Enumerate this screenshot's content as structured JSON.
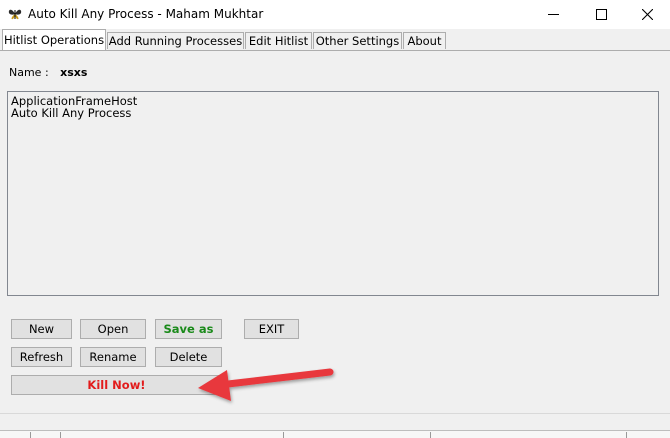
{
  "window": {
    "title": "Auto Kill Any Process - Maham Mukhtar"
  },
  "tabs": [
    {
      "label": "Hitlist Operations",
      "active": true
    },
    {
      "label": "Add Running Processes",
      "active": false
    },
    {
      "label": "Edit Hitlist",
      "active": false
    },
    {
      "label": "Other Settings",
      "active": false
    },
    {
      "label": "About",
      "active": false
    }
  ],
  "hitlist": {
    "name_label": "Name :",
    "name_value": "xsxs",
    "items": [
      "ApplicationFrameHost",
      "Auto Kill Any Process"
    ]
  },
  "buttons": {
    "new": "New",
    "open": "Open",
    "save_as": "Save as",
    "exit": "EXIT",
    "refresh": "Refresh",
    "rename": "Rename",
    "delete": "Delete",
    "kill_now": "Kill Now!"
  },
  "colors": {
    "save_as": "#1a8a1a",
    "kill_now": "#e21b1b",
    "annotation_arrow": "#e8383d"
  },
  "icons": {
    "app": "butterfly-icon",
    "minimize": "minimize-icon",
    "maximize": "maximize-icon",
    "close": "close-icon"
  }
}
